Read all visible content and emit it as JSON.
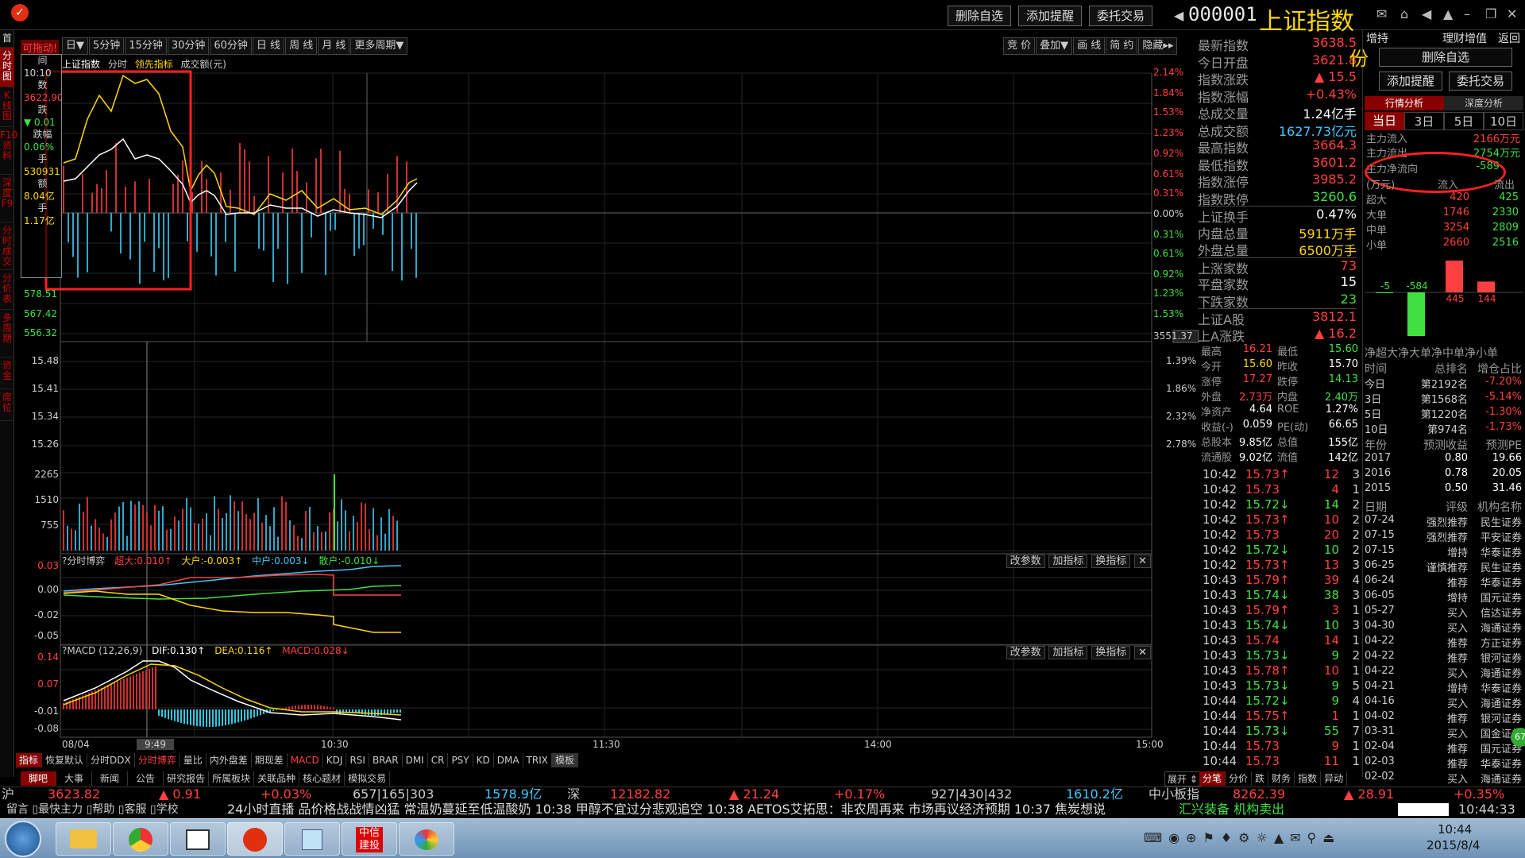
{
  "window": {
    "buttons": [
      "删除自选",
      "添加提醒",
      "委托交易"
    ],
    "code": "000001",
    "name": "上证指数",
    "right_header": [
      "增持",
      "理财增值",
      "返回"
    ]
  },
  "left_tabs": [
    "分时图",
    "K线图",
    "F10资料",
    "深度F9",
    "分时成交",
    "分价表",
    "多周期",
    "资金",
    "席位"
  ],
  "period_bar": [
    "日▼",
    "5分钟",
    "15分钟",
    "30分钟",
    "60分钟",
    "日 线",
    "周 线",
    "月 线",
    "更多周期▼"
  ],
  "right_tools": [
    "竞 价",
    "叠加▼",
    "画 线",
    "简 约",
    "隐藏▸▸"
  ],
  "main_chart": {
    "legend": [
      "上证指数",
      "分时",
      "领先指标",
      "成交额(元)"
    ],
    "left_axis": [
      "556.32",
      "567.42",
      "578.51"
    ],
    "right_axis": [
      "2.14%",
      "1.84%",
      "1.53%",
      "1.23%",
      "0.92%",
      "0.61%",
      "0.31%",
      "0.00%",
      "0.31%",
      "0.61%",
      "0.92%",
      "1.23%",
      "1.53%",
      "1.84%"
    ],
    "last_price_tag": "3551.37",
    "popup_labels": [
      "间",
      "10:10",
      "数",
      "3622.90",
      "跌",
      "0.01",
      "跌幅",
      "0.06%",
      "手",
      "530931",
      "额",
      "8.04亿",
      "手",
      "1.17亿"
    ],
    "popup_title": "可拖动!"
  },
  "mid_chart": {
    "left_axis": [
      "15.48",
      "15.41",
      "15.34",
      "15.26"
    ],
    "right_axis": [
      "1.39%",
      "1.86%",
      "2.32%",
      "2.78%"
    ]
  },
  "volume_chart": {
    "left_axis": [
      "2265",
      "1510",
      "755"
    ]
  },
  "bid_indicator": {
    "title": "?分时博弈",
    "labels": [
      "超大:0.010↑",
      "大户:-0.003↑",
      "中户:0.003↓",
      "散户:-0.010↓"
    ],
    "label_colors": [
      "#ff4040",
      "#ffd700",
      "#40c8ff",
      "#40e040"
    ],
    "left_axis": [
      "0.03",
      "0.00",
      "-0.02",
      "-0.05"
    ],
    "buttons": [
      "改参数",
      "加指标",
      "换指标",
      "✕"
    ]
  },
  "macd": {
    "title": "?MACD (12,26,9)",
    "labels": [
      "DIF:0.130↑",
      "DEA:0.116↑",
      "MACD:0.028↓"
    ],
    "label_colors": [
      "#ffffff",
      "#ffd700",
      "#ff4040"
    ],
    "left_axis": [
      "0.14",
      "0.07",
      "-0.01",
      "-0.08"
    ],
    "buttons": [
      "改参数",
      "加指标",
      "换指标",
      "✕"
    ]
  },
  "time_axis": [
    "08/04",
    "9:49",
    "10:30",
    "11:30",
    "14:00",
    "15:00"
  ],
  "bottom_tabs": [
    "指标",
    "恢复默认",
    "分时DDX",
    "分时博弈",
    "量比",
    "内外盘差",
    "期现差",
    "MACD",
    "KDJ",
    "RSI",
    "BRAR",
    "DMI",
    "CR",
    "PSY",
    "KD",
    "DMA",
    "TRIX",
    "模板"
  ],
  "bottom_tabs2": [
    "脚吧",
    "大事",
    "新闻",
    "公告",
    "研究报告",
    "所属板块",
    "关联品种",
    "核心题材",
    "模拟交易"
  ],
  "expand_label": "展开 ⇕",
  "right_bottom_tabs": [
    "分笔",
    "分价",
    "跌",
    "财务",
    "指数",
    "异动"
  ],
  "info_panel": [
    {
      "k": "最新指数",
      "v": "3638.5"
    },
    {
      "k": "今日开盘",
      "v": "3621.8"
    },
    {
      "k": "指数涨跌",
      "v": "▲ 15.5"
    },
    {
      "k": "指数涨幅",
      "v": "+0.43%"
    },
    {
      "k": "总成交量",
      "v": "1.24亿手"
    },
    {
      "k": "总成交额",
      "v": "1627.73亿元"
    },
    {
      "k": "最高指数",
      "v": "3664.3"
    },
    {
      "k": "最低指数",
      "v": "3601.2"
    },
    {
      "k": "指数涨停",
      "v": "3985.2"
    },
    {
      "k": "指数跌停",
      "v": "3260.6"
    },
    {
      "k": "上证换手",
      "v": "0.47%"
    },
    {
      "k": "内盘总量",
      "v": "5911万手"
    },
    {
      "k": "外盘总量",
      "v": "6500万手"
    },
    {
      "k": "上涨家数",
      "v": "73"
    },
    {
      "k": "平盘家数",
      "v": "15"
    },
    {
      "k": "下跌家数",
      "v": "23"
    },
    {
      "k": "上证A股",
      "v": "3812.1"
    },
    {
      "k": "上A涨跌",
      "v": "▲ 16.2"
    }
  ],
  "stock_quote": [
    {
      "k1": "最高",
      "v1": "16.21",
      "k2": "最低",
      "v2": "15.60"
    },
    {
      "k1": "今开",
      "v1": "15.60",
      "k2": "昨收",
      "v2": "15.70"
    },
    {
      "k1": "涨停",
      "v1": "17.27",
      "k2": "跌停",
      "v2": "14.13"
    },
    {
      "k1": "外盘",
      "v1": "2.73万",
      "k2": "内盘",
      "v2": "2.40万"
    },
    {
      "k1": "净资产",
      "v1": "4.64",
      "k2": "ROE",
      "v2": "1.27%"
    },
    {
      "k1": "收益(-)",
      "v1": "0.059",
      "k2": "PE(动)",
      "v2": "66.65"
    },
    {
      "k1": "总股本",
      "v1": "9.85亿",
      "k2": "总值",
      "v2": "155亿"
    },
    {
      "k1": "流通股",
      "v1": "9.02亿",
      "k2": "流值",
      "v2": "142亿"
    }
  ],
  "ticks": [
    [
      "10:42",
      "15.73↑",
      "12",
      "3"
    ],
    [
      "10:42",
      "15.73",
      "4",
      "1"
    ],
    [
      "10:42",
      "15.72↓",
      "14",
      "2"
    ],
    [
      "10:42",
      "15.73↑",
      "10",
      "2"
    ],
    [
      "10:42",
      "15.73",
      "20",
      "2"
    ],
    [
      "10:42",
      "15.72↓",
      "10",
      "2"
    ],
    [
      "10:42",
      "15.73↑",
      "13",
      "3"
    ],
    [
      "10:43",
      "15.79↑",
      "39",
      "4"
    ],
    [
      "10:43",
      "15.74↓",
      "38",
      "3"
    ],
    [
      "10:43",
      "15.79↑",
      "3",
      "1"
    ],
    [
      "10:43",
      "15.74↓",
      "10",
      "3"
    ],
    [
      "10:43",
      "15.74",
      "14",
      "1"
    ],
    [
      "10:43",
      "15.73↓",
      "9",
      "2"
    ],
    [
      "10:43",
      "15.78↑",
      "10",
      "1"
    ],
    [
      "10:43",
      "15.73↓",
      "9",
      "5"
    ],
    [
      "10:44",
      "15.72↓",
      "9",
      "4"
    ],
    [
      "10:44",
      "15.75↑",
      "1",
      "1"
    ],
    [
      "10:44",
      "15.73↓",
      "55",
      "7"
    ],
    [
      "10:44",
      "15.73",
      "9",
      "1"
    ],
    [
      "10:44",
      "15.73",
      "11",
      "1"
    ]
  ],
  "far_right": {
    "big_char": "份",
    "buttons": [
      "删除自选",
      "添加提醒",
      "委托交易"
    ],
    "tabs": [
      "行情分析",
      "深度分析"
    ],
    "periods": [
      "当日",
      "3日",
      "5日",
      "10日"
    ],
    "flow": [
      {
        "k": "主力流入",
        "v": "2166万元"
      },
      {
        "k": "主力流出",
        "v": "2754万元"
      },
      {
        "k": "主力净流向",
        "v": "-589"
      }
    ],
    "flow_header": [
      "(万元)",
      "流入",
      "流出"
    ],
    "orders": [
      {
        "k": "超大",
        "a": "420",
        "b": "425"
      },
      {
        "k": "大单",
        "a": "1746",
        "b": "2330"
      },
      {
        "k": "中单",
        "a": "3254",
        "b": "2809"
      },
      {
        "k": "小单",
        "a": "2660",
        "b": "2516"
      }
    ],
    "bar_values": [
      -5,
      -584,
      445,
      144
    ],
    "bar_labels": [
      "-5",
      "-584",
      "445",
      "144"
    ],
    "bar_footer": "净超大净大单净中单净小单",
    "holders_header": [
      "时间",
      "总排名",
      "增仓占比"
    ],
    "holders": [
      [
        "今日",
        "第2192名",
        "-7.20%"
      ],
      [
        "3日",
        "第1568名",
        "-5.14%"
      ],
      [
        "5日",
        "第1220名",
        "-1.30%"
      ],
      [
        "10日",
        "第974名",
        "-1.73%"
      ]
    ],
    "forecast_header": [
      "年份",
      "预测收益",
      "预测PE"
    ],
    "forecast": [
      [
        "2017",
        "0.80",
        "19.66"
      ],
      [
        "2016",
        "0.78",
        "20.05"
      ],
      [
        "2015",
        "0.50",
        "31.46"
      ]
    ],
    "rating_header": [
      "日期",
      "评级",
      "机构名称"
    ],
    "ratings": [
      [
        "07-24",
        "强烈推荐",
        "民生证券"
      ],
      [
        "07-15",
        "强烈推荐",
        "平安证券"
      ],
      [
        "07-15",
        "增持",
        "华泰证券"
      ],
      [
        "06-25",
        "谨慎推荐",
        "民生证券"
      ],
      [
        "06-24",
        "推荐",
        "华泰证券"
      ],
      [
        "06-05",
        "增持",
        "国元证券"
      ],
      [
        "05-27",
        "买入",
        "信达证券"
      ],
      [
        "04-30",
        "买入",
        "海通证券"
      ],
      [
        "04-22",
        "推荐",
        "方正证券"
      ],
      [
        "04-22",
        "推荐",
        "银河证券"
      ],
      [
        "04-22",
        "买入",
        "海通证券"
      ],
      [
        "04-21",
        "增持",
        "华泰证券"
      ],
      [
        "04-16",
        "买入",
        "海通证券"
      ],
      [
        "04-02",
        "推荐",
        "银河证券"
      ],
      [
        "03-31",
        "买入",
        "国金证券"
      ],
      [
        "02-04",
        "推荐",
        "国元证券"
      ],
      [
        "02-03",
        "推荐",
        "华泰证券"
      ],
      [
        "02-02",
        "买入",
        "海通证券"
      ]
    ]
  },
  "status_bar": {
    "items": [
      "沪",
      "3623.82",
      "▲ 0.91",
      "+0.03%",
      "657|165|303",
      "1578.9亿",
      "深",
      "12182.82",
      "▲ 21.24",
      "+0.17%",
      "927|430|432",
      "1610.2亿",
      "中小板指",
      "8262.39",
      "▲ 28.91",
      "+0.35%"
    ]
  },
  "news_bar": {
    "left": "留言 ▯最快主力 ▯帮助 ▯客服 ▯学校",
    "text": "24小时直播 品价格战战情凶猛  常温奶蔓延至低温酸奶  10:38  甲醇不宜过分悲观追空   10:38  AETOS艾拓思：非农周再来  市场再议经济预期   10:37  焦炭想说  ",
    "right": "汇兴装备  机构卖出 ",
    "clock": "10:44:33"
  },
  "taskbar": {
    "time": "10:44",
    "date": "2015/8/4"
  }
}
